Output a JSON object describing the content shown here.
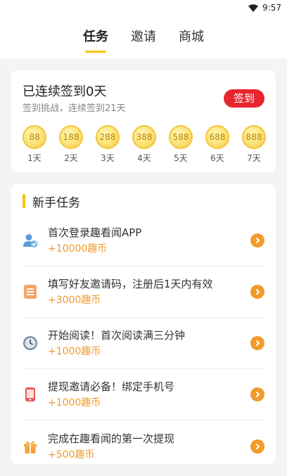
{
  "status_bar": {
    "time": "9:57"
  },
  "tabs": [
    {
      "label": "任务",
      "active": true
    },
    {
      "label": "邀请",
      "active": false
    },
    {
      "label": "商城",
      "active": false
    }
  ],
  "checkin": {
    "title": "已连续签到0天",
    "subtitle": "签到挑战，连续签到21天",
    "button_label": "签到",
    "days": [
      {
        "coins": "88",
        "label": "1天"
      },
      {
        "coins": "188",
        "label": "2天"
      },
      {
        "coins": "288",
        "label": "3天"
      },
      {
        "coins": "388",
        "label": "4天"
      },
      {
        "coins": "588",
        "label": "5天"
      },
      {
        "coins": "688",
        "label": "6天"
      },
      {
        "coins": "888",
        "label": "7天"
      }
    ]
  },
  "tasks": {
    "header": "新手任务",
    "items": [
      {
        "icon": "user-check-icon",
        "title": "首次登录趣看闻APP",
        "reward": "+10000趣币"
      },
      {
        "icon": "document-icon",
        "title": "填写好友邀请码，注册后1天内有效",
        "reward": "+3000趣币"
      },
      {
        "icon": "clock-icon",
        "title": "开始阅读！首次阅读满三分钟",
        "reward": "+1000趣币"
      },
      {
        "icon": "phone-icon",
        "title": "提现邀请必备！绑定手机号",
        "reward": "+1000趣币"
      },
      {
        "icon": "gift-icon",
        "title": "完成在趣看闻的第一次提现",
        "reward": "+500趣币"
      }
    ]
  },
  "colors": {
    "accent_yellow": "#f7c300",
    "checkin_red": "#e8262f",
    "reward_orange": "#f09a2a",
    "arrow_orange": "#f29b2c"
  }
}
